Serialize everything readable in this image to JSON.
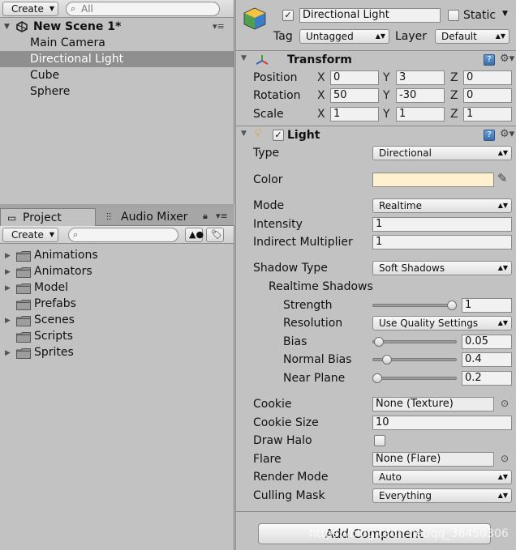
{
  "hierarchy": {
    "create_label": "Create",
    "search_value": "All",
    "scene_name": "New Scene 1*",
    "items": [
      "Main Camera",
      "Directional Light",
      "Cube",
      "Sphere"
    ],
    "selected_item": "Directional Light"
  },
  "project": {
    "tabs": [
      "Project",
      "Audio Mixer"
    ],
    "create_label": "Create",
    "folders": [
      {
        "name": "Animations",
        "expandable": true
      },
      {
        "name": "Animators",
        "expandable": true
      },
      {
        "name": "Model",
        "expandable": true
      },
      {
        "name": "Prefabs",
        "expandable": false
      },
      {
        "name": "Scenes",
        "expandable": true
      },
      {
        "name": "Scripts",
        "expandable": false
      },
      {
        "name": "Sprites",
        "expandable": true
      }
    ]
  },
  "inspector": {
    "object_name": "Directional Light",
    "static_label": "Static",
    "tag_label": "Tag",
    "tag_value": "Untagged",
    "layer_label": "Layer",
    "layer_value": "Default",
    "transform": {
      "title": "Transform",
      "rows": [
        {
          "label": "Position",
          "x": "0",
          "y": "3",
          "z": "0"
        },
        {
          "label": "Rotation",
          "x": "50",
          "y": "-30",
          "z": "0"
        },
        {
          "label": "Scale",
          "x": "1",
          "y": "1",
          "z": "1"
        }
      ],
      "axis_x": "X",
      "axis_y": "Y",
      "axis_z": "Z"
    },
    "light": {
      "title": "Light",
      "type_label": "Type",
      "type_value": "Directional",
      "color_label": "Color",
      "color_value": "#fff0d0",
      "mode_label": "Mode",
      "mode_value": "Realtime",
      "intensity_label": "Intensity",
      "intensity_value": "1",
      "indirect_label": "Indirect Multiplier",
      "indirect_value": "1",
      "shadow_type_label": "Shadow Type",
      "shadow_type_value": "Soft Shadows",
      "realtime_shadows_label": "Realtime Shadows",
      "strength_label": "Strength",
      "strength_value": "1",
      "strength_fraction": 1.0,
      "resolution_label": "Resolution",
      "resolution_value": "Use Quality Settings",
      "bias_label": "Bias",
      "bias_value": "0.05",
      "bias_fraction": 0.025,
      "normal_bias_label": "Normal Bias",
      "normal_bias_value": "0.4",
      "normal_bias_fraction": 0.133,
      "near_plane_label": "Near Plane",
      "near_plane_value": "0.2",
      "near_plane_fraction": 0.0,
      "cookie_label": "Cookie",
      "cookie_value": "None (Texture)",
      "cookie_size_label": "Cookie Size",
      "cookie_size_value": "10",
      "draw_halo_label": "Draw Halo",
      "flare_label": "Flare",
      "flare_value": "None (Flare)",
      "render_mode_label": "Render Mode",
      "render_mode_value": "Auto",
      "culling_mask_label": "Culling Mask",
      "culling_mask_value": "Everything"
    },
    "add_component_label": "Add Component",
    "watermark": "https://blog.csdn.net/qq_36450306"
  },
  "colors": {
    "panel_bg": "#c2c2c2",
    "selection": "#8f8f8f",
    "light_color": "#fff0d0"
  }
}
